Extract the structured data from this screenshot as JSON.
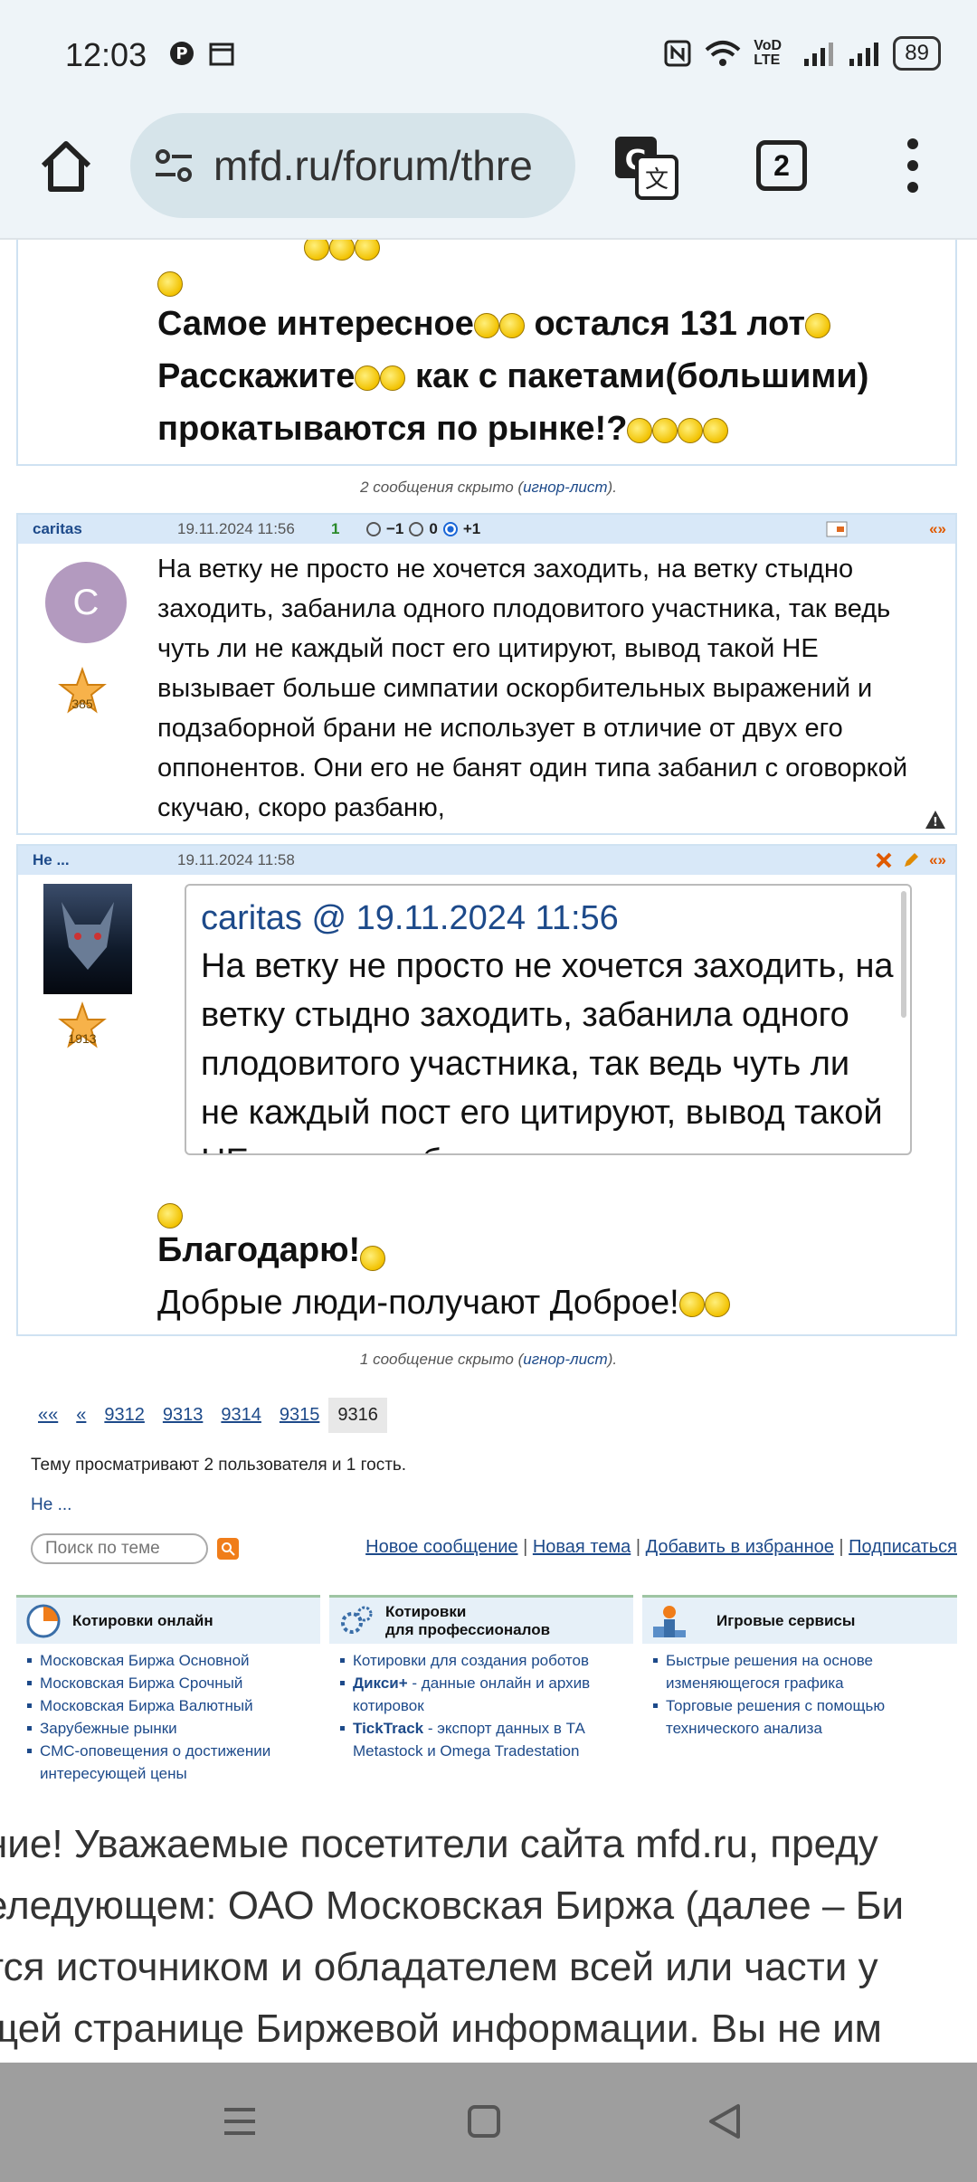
{
  "status": {
    "time": "12:03",
    "network": "VoD LTE",
    "battery": "89"
  },
  "browser": {
    "url": "mfd.ru/forum/thre",
    "tabs_count": "2"
  },
  "post1": {
    "line1": "Самое интересное",
    "line1b": " остался 131 лот",
    "line2": "Расскажите",
    "line2b": " как с пакетами(большими)",
    "line3": "прокатываются по рынке!?"
  },
  "hidden1": {
    "text": "2 сообщения скрыто (",
    "link": "игнор-лист",
    "tail": ")."
  },
  "post2": {
    "author": "caritas",
    "date": "19.11.2024 11:56",
    "score": "1",
    "vote_minus": "−1",
    "vote_zero": "0",
    "vote_plus": "+1",
    "reply": "«»",
    "avatar_letter": "C",
    "rating": "385",
    "text": "На ветку не просто не хочется заходить, на ветку стыдно заходить, забанила одного плодовитого участника, так ведь чуть ли не каждый пост его цитируют, вывод такой НЕ вызывает больше симпатии оскорбительных выражений и подзаборной брани не использует в отличие от двух его оппонентов. Они его не банят один типа забанил с оговоркой скучаю, скоро разбаню,"
  },
  "post3": {
    "author": "Не ...",
    "date": "19.11.2024 11:58",
    "reply": "«»",
    "rating": "1913",
    "quote_author": "caritas",
    "quote_at": " @ ",
    "quote_date": "19.11.2024 11:56",
    "quote_text": "На ветку не просто не хочется заходить, на ветку стыдно заходить, забанила одного плодовитого участника, так ведь чуть ли не каждый пост его цитируют, вывод такой НЕ вызывает больше",
    "line1": "Благодарю!",
    "line2": "Добрые люди-получают Доброе!"
  },
  "hidden2": {
    "text": "1 сообщение скрыто (",
    "link": "игнор-лист",
    "tail": ")."
  },
  "pagination": {
    "first": "««",
    "prev": "«",
    "pages": [
      "9312",
      "9313",
      "9314",
      "9315",
      "9316"
    ]
  },
  "viewers": "Тему просматривают 2 пользователя и 1 гость.",
  "viewer_link": "Не ...",
  "search": {
    "placeholder": "Поиск по теме"
  },
  "actions": {
    "new_message": "Новое сообщение",
    "new_topic": "Новая тема",
    "add_fav": "Добавить в избранное",
    "subscribe": "Подписаться",
    "sep": " | "
  },
  "footer": {
    "col1": {
      "title": "Котировки онлайн",
      "items": [
        "Московская Биржа Основной",
        "Московская Биржа Срочный",
        "Московская Биржа Валютный",
        "Зарубежные рынки",
        "СМС-оповещения о достижении интересующей цены"
      ]
    },
    "col2": {
      "title1": "Котировки",
      "title2": "для профессионалов",
      "item1": "Котировки для создания роботов",
      "item2_bold": "Дикси+",
      "item2_rest": " - данные онлайн и архив котировок",
      "item3_bold": "TickTrack",
      "item3_rest": " - экспорт данных в ТА Metastock и Omega Tradestation"
    },
    "col3": {
      "title": "Игровые сервисы",
      "items": [
        "Быстрые решения на основе изменяющегося графика",
        "Торговые решения с помощью технического анализа"
      ]
    }
  },
  "disclaimer": [
    "ние! Уважаемые посетители сайта mfd.ru, преду",
    "еледующем: ОАО Московская Биржа (далее – Би",
    "тся источником и обладателем всей или части у",
    "щей странице Биржевой информации. Вы не им"
  ]
}
